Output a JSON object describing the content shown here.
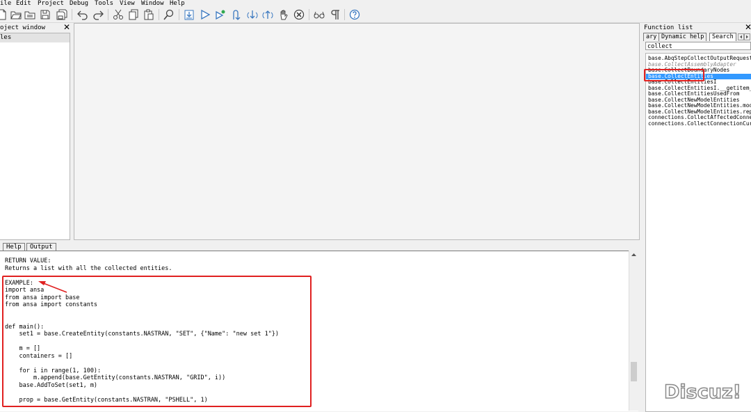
{
  "menu": [
    "ile",
    "Edit",
    "Project",
    "Debug",
    "Tools",
    "View",
    "Window",
    "Help"
  ],
  "toolbar": {
    "icons": [
      "new-file-icon",
      "open-folder-icon",
      "open-file-icon",
      "save-icon",
      "save-all-icon",
      "undo-icon",
      "redo-icon",
      "cut-icon",
      "copy-icon",
      "paste-icon",
      "find-icon",
      "import-icon",
      "run-icon",
      "run-to-cursor-icon",
      "step-into-icon",
      "step-over-icon",
      "step-out-icon",
      "stop-hand-icon",
      "cancel-icon",
      "glasses-icon",
      "pilcrow-icon",
      "help-icon"
    ]
  },
  "project_window": {
    "title": "oject window",
    "close": "✕",
    "files_label": "les"
  },
  "bottom_tabs": {
    "help": "Help",
    "output": "Output"
  },
  "help_lines": [
    "RETURN VALUE:",
    "Returns a list with all the collected entities.",
    "",
    "EXAMPLE:",
    "import ansa",
    "from ansa import base",
    "from ansa import constants",
    "",
    "",
    "def main():",
    "    set1 = base.CreateEntity(constants.NASTRAN, \"SET\", {\"Name\": \"new set 1\"})",
    "",
    "    m = []",
    "    containers = []",
    "",
    "    for i in range(1, 100):",
    "        m.append(base.GetEntity(constants.NASTRAN, \"GRID\", i))",
    "    base.AddToSet(set1, m)",
    "",
    "    prop = base.GetEntity(constants.NASTRAN, \"PSHELL\", 1)"
  ],
  "function_list": {
    "title": "Function list",
    "close": "✕",
    "tabs": [
      "ary",
      "Dynamic help",
      "Search"
    ],
    "search_value": "collect",
    "items": [
      {
        "text": "base.AbqStepCollectOutputRequest",
        "style": "normal"
      },
      {
        "text": "base.CollectAssemblyAdapter",
        "style": "italic"
      },
      {
        "text": "base.CollectBoundaryNodes",
        "style": "normal"
      },
      {
        "text": "base.CollectEntities",
        "style": "selected"
      },
      {
        "text": "base.CollectEntitiesI",
        "style": "normal"
      },
      {
        "text": "base.CollectEntitiesI.__getitem_",
        "style": "normal"
      },
      {
        "text": "base.CollectEntitiesUsedFrom",
        "style": "normal"
      },
      {
        "text": "base.CollectNewModelEntities",
        "style": "normal"
      },
      {
        "text": "base.CollectNewModelEntities.mod",
        "style": "normal"
      },
      {
        "text": "base.CollectNewModelEntities.rep",
        "style": "normal"
      },
      {
        "text": "connections.CollectAffectedConne",
        "style": "normal"
      },
      {
        "text": "connections.CollectConnectionCur",
        "style": "normal"
      }
    ]
  },
  "watermark": "Discuz!",
  "colors": {
    "accent_red": "#e02020",
    "selection": "#3399ff"
  }
}
